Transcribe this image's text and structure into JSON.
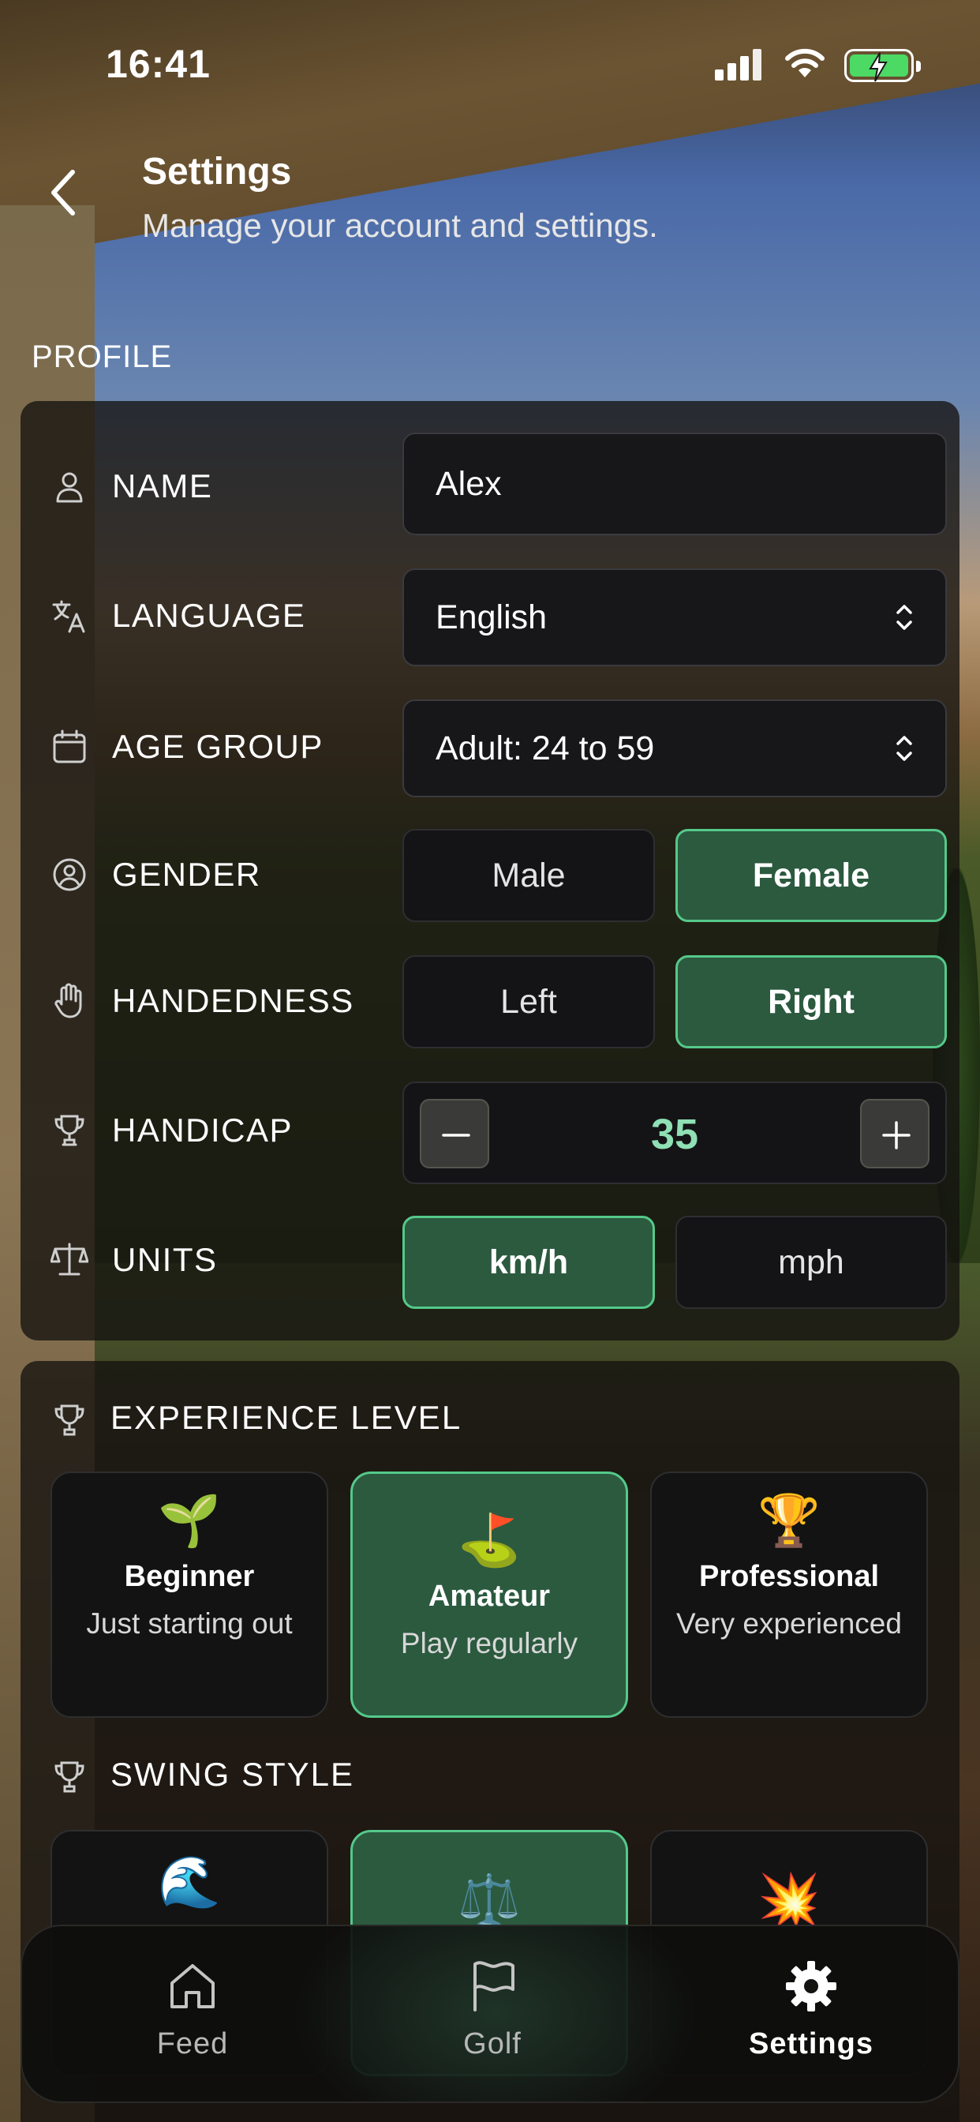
{
  "status_bar": {
    "time": "16:41"
  },
  "header": {
    "title": "Settings",
    "subtitle": "Manage your account and settings."
  },
  "profile": {
    "section_label": "PROFILE",
    "name": {
      "label": "NAME",
      "value": "Alex"
    },
    "language": {
      "label": "LANGUAGE",
      "value": "English"
    },
    "age_group": {
      "label": "AGE GROUP",
      "value": "Adult: 24 to 59"
    },
    "gender": {
      "label": "GENDER",
      "options": [
        "Male",
        "Female"
      ],
      "selected": "Female"
    },
    "handedness": {
      "label": "HANDEDNESS",
      "options": [
        "Left",
        "Right"
      ],
      "selected": "Right"
    },
    "handicap": {
      "label": "HANDICAP",
      "value": "35"
    },
    "units": {
      "label": "UNITS",
      "options": [
        "km/h",
        "mph"
      ],
      "selected": "km/h"
    }
  },
  "experience": {
    "label": "EXPERIENCE LEVEL",
    "selected": "Amateur",
    "options": [
      {
        "emoji": "🌱",
        "title": "Beginner",
        "desc": "Just starting out"
      },
      {
        "emoji": "⛳",
        "title": "Amateur",
        "desc": "Play regularly"
      },
      {
        "emoji": "🏆",
        "title": "Professional",
        "desc": "Very experienced"
      }
    ]
  },
  "swing": {
    "label": "SWING STYLE",
    "options": [
      {
        "emoji": "🌊"
      },
      {
        "emoji": "⚖️"
      },
      {
        "emoji": "💥"
      }
    ],
    "selected_index": 1
  },
  "tabs": [
    {
      "label": "Feed",
      "icon": "home-icon"
    },
    {
      "label": "Golf",
      "icon": "flag-icon"
    },
    {
      "label": "Settings",
      "icon": "gear-icon",
      "active": true
    }
  ],
  "colors": {
    "accent": "#2b5a3f",
    "accent_border": "#55c98a",
    "handicap_value": "#8fe0b4",
    "battery": "#4cd964"
  }
}
